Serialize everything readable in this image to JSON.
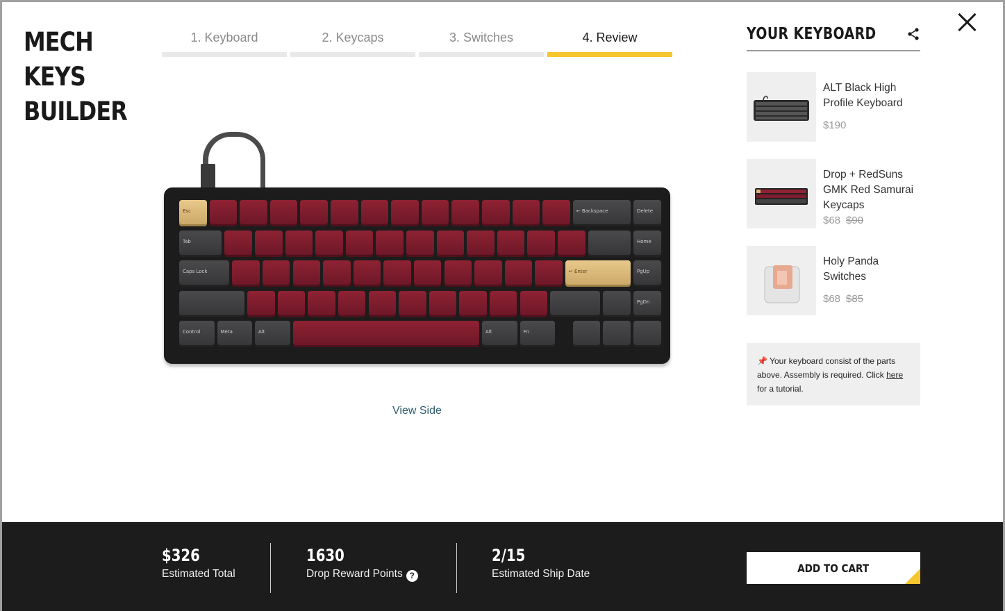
{
  "brand": {
    "line1": "MECH KEYS",
    "line2": "BUILDER"
  },
  "steps": [
    {
      "label": "1. Keyboard",
      "active": false
    },
    {
      "label": "2. Keycaps",
      "active": false
    },
    {
      "label": "3. Switches",
      "active": false
    },
    {
      "label": "4. Review",
      "active": true
    }
  ],
  "preview": {
    "view_side_label": "View Side"
  },
  "panel": {
    "title": "YOUR KEYBOARD",
    "items": [
      {
        "name": "ALT Black High Profile Keyboard",
        "price": "$190",
        "old_price": ""
      },
      {
        "name": "Drop + RedSuns GMK Red Samurai Keycaps",
        "price": "$68",
        "old_price": "$90"
      },
      {
        "name": "Holy Panda Switches",
        "price": "$68",
        "old_price": "$85"
      }
    ],
    "note": {
      "text": "Your keyboard consist of the parts above. Assembly is required. Click",
      "link": "here",
      "after": "for a tutorial."
    }
  },
  "footer": {
    "total_value": "$326",
    "total_label": "Estimated Total",
    "points_value": "1630",
    "points_label": "Drop Reward Points",
    "ship_value": "2/15",
    "ship_label": "Estimated Ship Date",
    "cart_label": "ADD TO CART"
  },
  "keyboard_legends": {
    "esc": "Esc",
    "backspace": "← Backspace",
    "delete": "Delete",
    "tab": "Tab",
    "home": "Home",
    "caps": "Caps Lock",
    "enter": "↵ Enter",
    "pgup": "PgUp",
    "pgdn": "PgDn",
    "control": "Control",
    "meta": "Meta",
    "alt": "Alt",
    "alt2": "Alt",
    "fn": "Fn"
  },
  "colors": {
    "accent": "#f6c62f",
    "footer_bg": "#1c1c1c",
    "keycap_red": "#7d1c2d",
    "keycap_cream": "#d9b77a"
  }
}
